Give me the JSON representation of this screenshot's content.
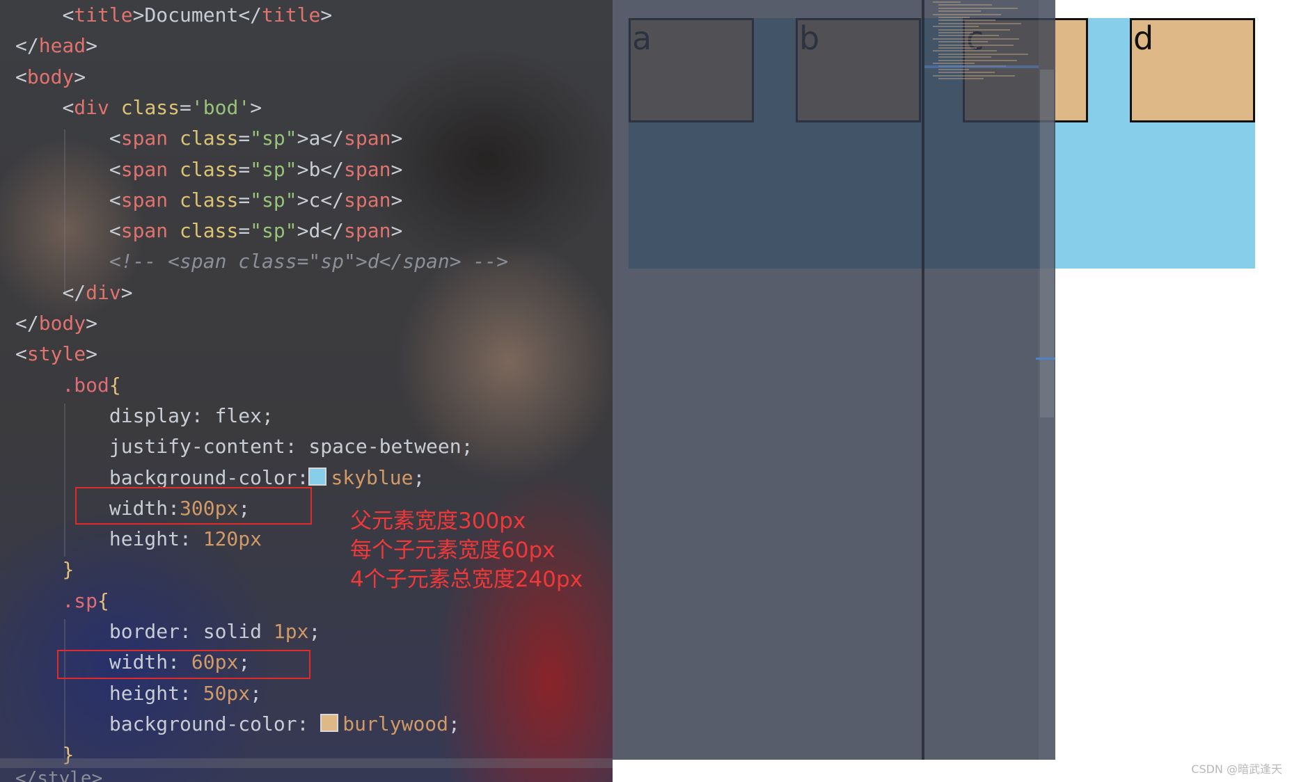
{
  "code_lines": [
    [
      {
        "t": "    ",
        "c": "p"
      },
      {
        "t": "<",
        "c": "p"
      },
      {
        "t": "title",
        "c": "t"
      },
      {
        "t": ">",
        "c": "p"
      },
      {
        "t": "Document",
        "c": "p"
      },
      {
        "t": "</",
        "c": "p"
      },
      {
        "t": "title",
        "c": "t"
      },
      {
        "t": ">",
        "c": "p"
      }
    ],
    [
      {
        "t": "</",
        "c": "p"
      },
      {
        "t": "head",
        "c": "t"
      },
      {
        "t": ">",
        "c": "p"
      }
    ],
    [
      {
        "t": "<",
        "c": "p"
      },
      {
        "t": "body",
        "c": "t"
      },
      {
        "t": ">",
        "c": "p"
      }
    ],
    [
      {
        "t": "    ",
        "c": "p"
      },
      {
        "t": "<",
        "c": "p"
      },
      {
        "t": "div",
        "c": "t"
      },
      {
        "t": " class",
        "c": "a"
      },
      {
        "t": "=",
        "c": "p"
      },
      {
        "t": "'bod'",
        "c": "s"
      },
      {
        "t": ">",
        "c": "p"
      }
    ],
    [
      {
        "t": "        ",
        "c": "p"
      },
      {
        "t": "<",
        "c": "p"
      },
      {
        "t": "span",
        "c": "t"
      },
      {
        "t": " class",
        "c": "a"
      },
      {
        "t": "=",
        "c": "p"
      },
      {
        "t": "\"sp\"",
        "c": "s"
      },
      {
        "t": ">a</",
        "c": "p"
      },
      {
        "t": "span",
        "c": "t"
      },
      {
        "t": ">",
        "c": "p"
      }
    ],
    [
      {
        "t": "        ",
        "c": "p"
      },
      {
        "t": "<",
        "c": "p"
      },
      {
        "t": "span",
        "c": "t"
      },
      {
        "t": " class",
        "c": "a"
      },
      {
        "t": "=",
        "c": "p"
      },
      {
        "t": "\"sp\"",
        "c": "s"
      },
      {
        "t": ">b</",
        "c": "p"
      },
      {
        "t": "span",
        "c": "t"
      },
      {
        "t": ">",
        "c": "p"
      }
    ],
    [
      {
        "t": "        ",
        "c": "p"
      },
      {
        "t": "<",
        "c": "p"
      },
      {
        "t": "span",
        "c": "t"
      },
      {
        "t": " class",
        "c": "a"
      },
      {
        "t": "=",
        "c": "p"
      },
      {
        "t": "\"sp\"",
        "c": "s"
      },
      {
        "t": ">c</",
        "c": "p"
      },
      {
        "t": "span",
        "c": "t"
      },
      {
        "t": ">",
        "c": "p"
      }
    ],
    [
      {
        "t": "        ",
        "c": "p"
      },
      {
        "t": "<",
        "c": "p"
      },
      {
        "t": "span",
        "c": "t"
      },
      {
        "t": " class",
        "c": "a"
      },
      {
        "t": "=",
        "c": "p"
      },
      {
        "t": "\"sp\"",
        "c": "s"
      },
      {
        "t": ">d</",
        "c": "p"
      },
      {
        "t": "span",
        "c": "t"
      },
      {
        "t": ">",
        "c": "p"
      }
    ],
    [
      {
        "t": "        ",
        "c": "p"
      },
      {
        "t": "<!-- <span class=\"sp\">d</span> -->",
        "c": "c"
      }
    ],
    [
      {
        "t": "    ",
        "c": "p"
      },
      {
        "t": "</",
        "c": "p"
      },
      {
        "t": "div",
        "c": "t"
      },
      {
        "t": ">",
        "c": "p"
      }
    ],
    [
      {
        "t": "</",
        "c": "p"
      },
      {
        "t": "body",
        "c": "t"
      },
      {
        "t": ">",
        "c": "p"
      }
    ],
    [
      {
        "t": "<",
        "c": "p"
      },
      {
        "t": "style",
        "c": "t"
      },
      {
        "t": ">",
        "c": "p"
      }
    ],
    [
      {
        "t": "    ",
        "c": "p"
      },
      {
        "t": ".bod",
        "c": "sel"
      },
      {
        "t": "{",
        "c": "br"
      }
    ],
    [
      {
        "t": "        display: flex;",
        "c": "p"
      }
    ],
    [
      {
        "t": "        justify-content: space-between;",
        "c": "p"
      }
    ],
    [
      {
        "t": "        background-color:",
        "c": "p"
      },
      {
        "t": "",
        "c": "swatch",
        "color": "#87ceeb"
      },
      {
        "t": "skyblue",
        "c": "n"
      },
      {
        "t": ";",
        "c": "p"
      }
    ],
    [
      {
        "t": "        width:",
        "c": "p"
      },
      {
        "t": "300px",
        "c": "n"
      },
      {
        "t": ";",
        "c": "p"
      }
    ],
    [
      {
        "t": "        height: ",
        "c": "p"
      },
      {
        "t": "120px",
        "c": "n"
      }
    ],
    [
      {
        "t": "    ",
        "c": "p"
      },
      {
        "t": "}",
        "c": "br"
      }
    ],
    [
      {
        "t": "    ",
        "c": "p"
      },
      {
        "t": ".sp",
        "c": "sel"
      },
      {
        "t": "{",
        "c": "br"
      }
    ],
    [
      {
        "t": "        border: solid ",
        "c": "p"
      },
      {
        "t": "1px",
        "c": "n"
      },
      {
        "t": ";",
        "c": "p"
      }
    ],
    [
      {
        "t": "        width: ",
        "c": "p"
      },
      {
        "t": "60px",
        "c": "n"
      },
      {
        "t": ";",
        "c": "p"
      }
    ],
    [
      {
        "t": "        height: ",
        "c": "p"
      },
      {
        "t": "50px",
        "c": "n"
      },
      {
        "t": ";",
        "c": "p"
      }
    ],
    [
      {
        "t": "        background-color: ",
        "c": "p"
      },
      {
        "t": "",
        "c": "swatch",
        "color": "#deb887"
      },
      {
        "t": "burlywood",
        "c": "n"
      },
      {
        "t": ";",
        "c": "p"
      }
    ],
    [
      {
        "t": "    ",
        "c": "p"
      },
      {
        "t": "}",
        "c": "br"
      }
    ]
  ],
  "bottom_line": "</style>",
  "annotations": [
    "父元素宽度300px",
    "每个子元素宽度60px",
    "4个子元素总宽度240px"
  ],
  "preview_items": [
    "a",
    "b",
    "c",
    "d"
  ],
  "colors": {
    "container": "#87ceeb",
    "item": "#deb887",
    "annotation": "#f03838",
    "highlight_box": "#e22a2a"
  },
  "watermark": "CSDN @暗武逢天"
}
